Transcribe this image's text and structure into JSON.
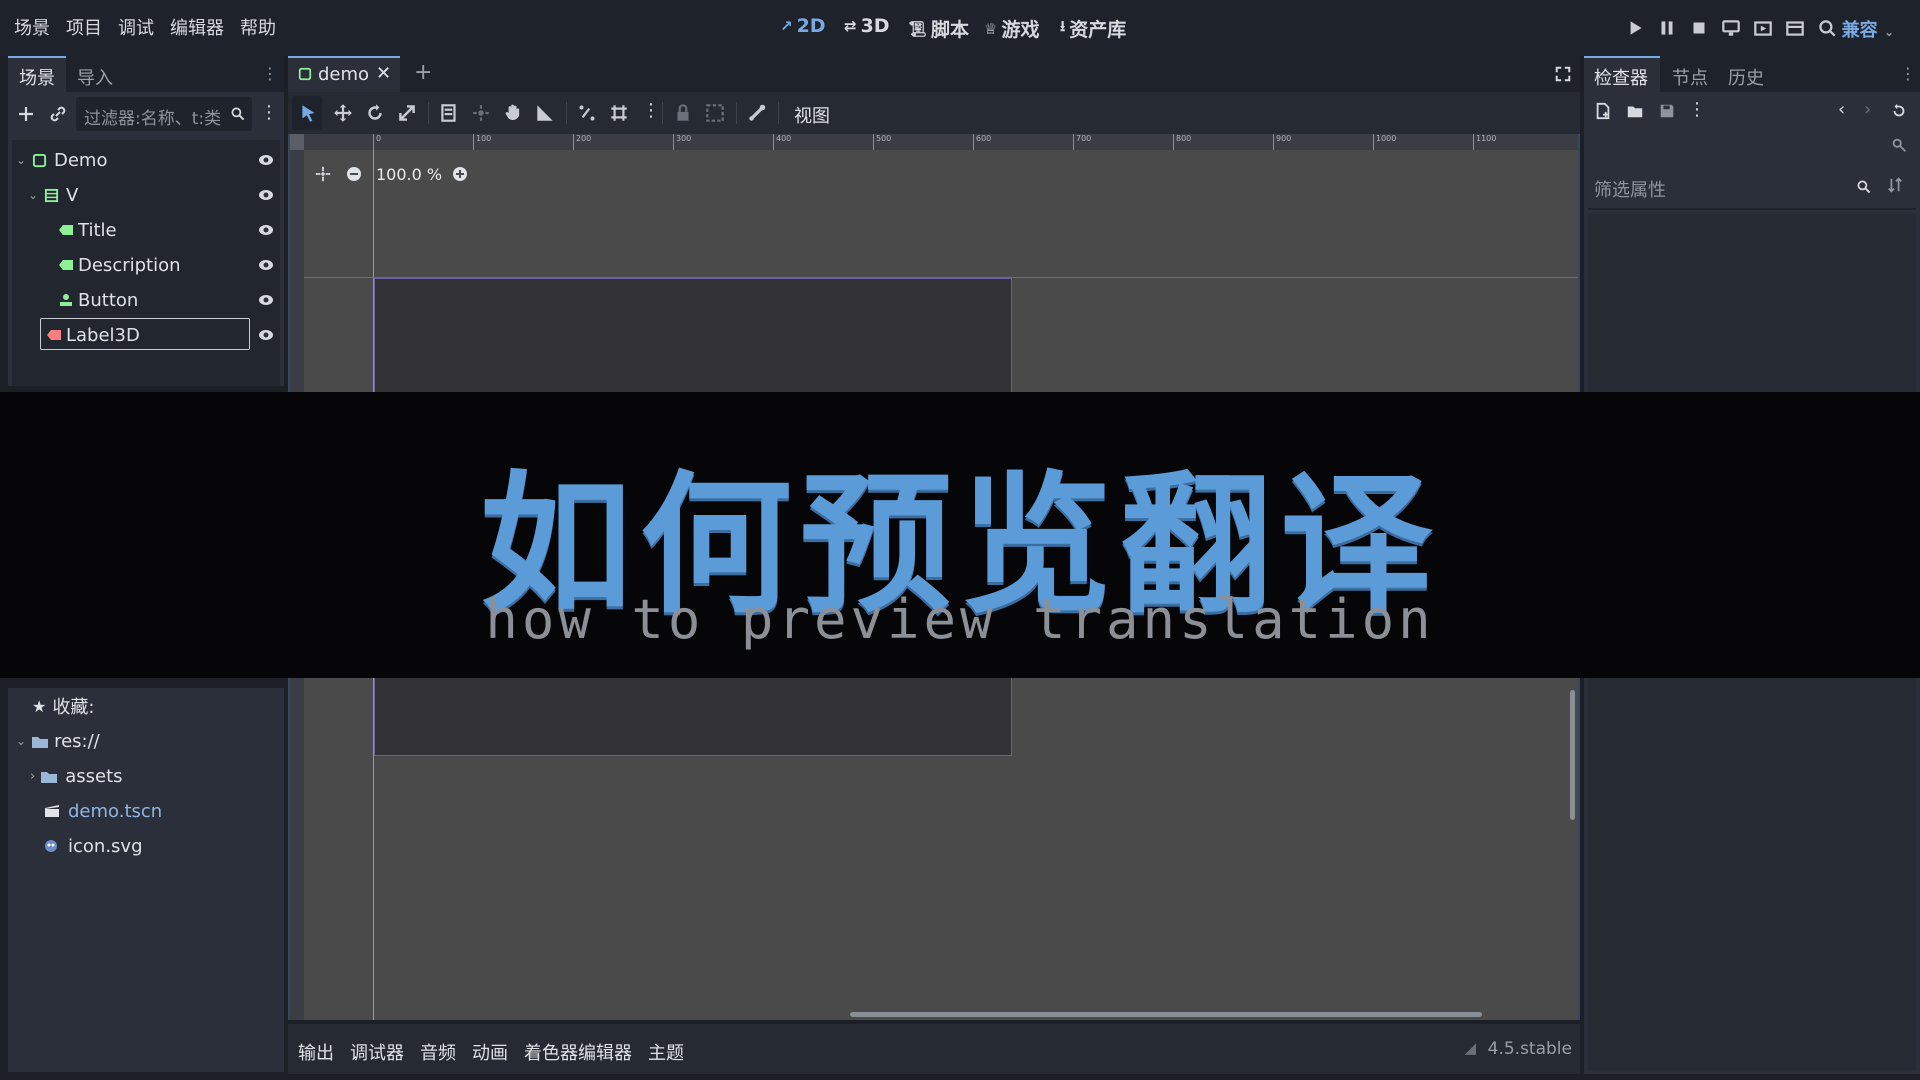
{
  "menu": [
    "场景",
    "项目",
    "调试",
    "编辑器",
    "帮助"
  ],
  "workspaces": [
    {
      "label": "2D",
      "active": true
    },
    {
      "label": "3D",
      "active": false
    },
    {
      "label": "脚本",
      "active": false
    },
    {
      "label": "游戏",
      "active": false
    },
    {
      "label": "资产库",
      "active": false
    }
  ],
  "renderer": "兼容",
  "scene_dock": {
    "tabs": [
      "场景",
      "导入"
    ],
    "filter_placeholder": "过滤器:名称、t:类",
    "nodes": [
      {
        "label": "Demo",
        "icon": "control-node-icon"
      },
      {
        "label": "V",
        "icon": "vbox-container-icon"
      },
      {
        "label": "Title",
        "icon": "label-node-icon"
      },
      {
        "label": "Description",
        "icon": "label-node-icon"
      },
      {
        "label": "Button",
        "icon": "button-node-icon"
      },
      {
        "label": "Label3D",
        "icon": "label3d-node-icon"
      }
    ]
  },
  "filesystem": {
    "favorites": "收藏:",
    "root": "res://",
    "items": [
      {
        "label": "assets",
        "type": "folder"
      },
      {
        "label": "demo.tscn",
        "type": "scene"
      },
      {
        "label": "icon.svg",
        "type": "image"
      }
    ]
  },
  "editor": {
    "doc_tab": "demo",
    "zoom": "100.0 %",
    "view_menu": "视图",
    "ruler_labels": [
      "0",
      "100",
      "200",
      "300",
      "400",
      "500",
      "600",
      "700",
      "800",
      "900",
      "1000",
      "1100"
    ]
  },
  "bottom_tabs": [
    "输出",
    "调试器",
    "音频",
    "动画",
    "着色器编辑器",
    "主题"
  ],
  "version": "4.5.stable",
  "inspector": {
    "tabs": [
      "检查器",
      "节点",
      "历史"
    ],
    "filter_placeholder": "筛选属性"
  },
  "overlay": {
    "title": "如何预览翻译",
    "subtitle": "how to preview translation"
  },
  "colors": {
    "accent": "#78a9e3",
    "control_node": "#8eef97",
    "label3d_node": "#fc7f7f",
    "overlay_title": "#5b9bd8"
  }
}
